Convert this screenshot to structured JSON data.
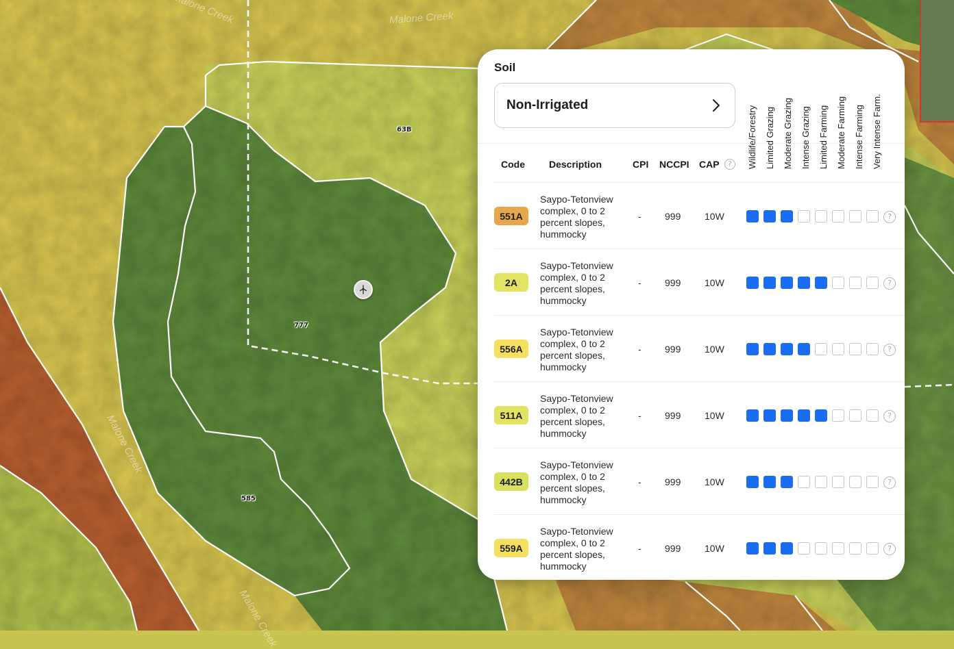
{
  "map": {
    "creek_labels": [
      "Malone Creek",
      "Malone Creek",
      "Malone Creek",
      "Malone Creek"
    ],
    "unit_labels": [
      "63B",
      "777",
      "585"
    ],
    "colors": {
      "dark_green": "#5e8a3b",
      "light_green": "#c7d159",
      "yellow": "#d7c650",
      "orange": "#c0873e",
      "red_orange": "#b85f30",
      "boundary": "#ffffff"
    }
  },
  "panel": {
    "title": "Soil",
    "select_value": "Non-Irrigated",
    "columns": {
      "code": "Code",
      "description": "Description",
      "cpi": "CPI",
      "nccpi": "NCCPI",
      "cap": "CAP"
    },
    "suitability_headers": [
      "Wildlife/Forestry",
      "Limited Grazing",
      "Moderate Grazing",
      "Intense Grazing",
      "Limited Farming",
      "Moderate Farming",
      "Intense Farming",
      "Very Intense Farm."
    ],
    "rows": [
      {
        "code": "551A",
        "badge_color": "#e8a64a",
        "description": "Saypo-Tetonview complex, 0 to 2 percent slopes, hummocky",
        "cpi": "-",
        "nccpi": "999",
        "cap": "10W",
        "level": 3
      },
      {
        "code": "2A",
        "badge_color": "#e2e362",
        "description": "Saypo-Tetonview complex, 0 to 2 percent slopes, hummocky",
        "cpi": "-",
        "nccpi": "999",
        "cap": "10W",
        "level": 5
      },
      {
        "code": "556A",
        "badge_color": "#f5df5e",
        "description": "Saypo-Tetonview complex, 0 to 2 percent slopes, hummocky",
        "cpi": "-",
        "nccpi": "999",
        "cap": "10W",
        "level": 4
      },
      {
        "code": "511A",
        "badge_color": "#e2e362",
        "description": "Saypo-Tetonview complex, 0 to 2 percent slopes, hummocky",
        "cpi": "-",
        "nccpi": "999",
        "cap": "10W",
        "level": 5
      },
      {
        "code": "442B",
        "badge_color": "#d9df5f",
        "description": "Saypo-Tetonview complex, 0 to 2 percent slopes, hummocky",
        "cpi": "-",
        "nccpi": "999",
        "cap": "10W",
        "level": 3
      },
      {
        "code": "559A",
        "badge_color": "#f5df5e",
        "description": "Saypo-Tetonview complex, 0 to 2 percent slopes, hummocky",
        "cpi": "-",
        "nccpi": "999",
        "cap": "10W",
        "level": 3
      }
    ],
    "icons": {
      "select": "chevron-right-icon",
      "help": "question-circle-icon",
      "marker": "wind-turbine-icon"
    },
    "accent_color": "#1a6df0"
  }
}
